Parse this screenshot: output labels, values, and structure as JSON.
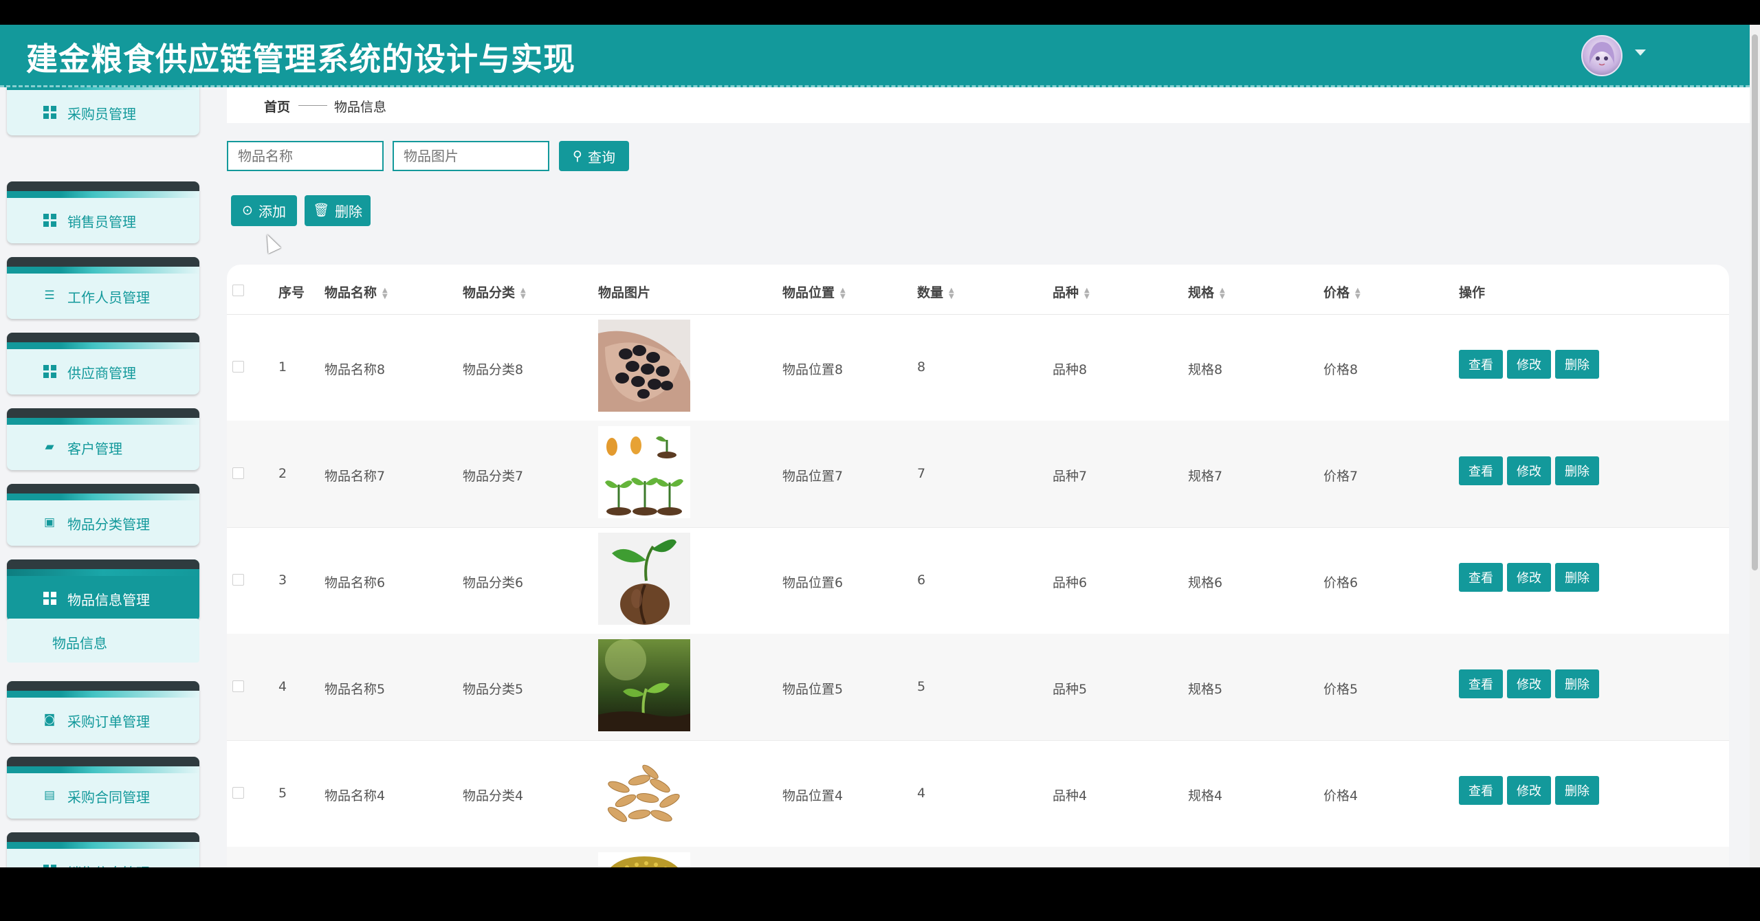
{
  "header": {
    "title": "建金粮食供应链管理系统的设计与实现"
  },
  "sidebar": {
    "items": [
      {
        "label": "采购员管理",
        "icon": "grid-icon"
      },
      {
        "label": "销售员管理",
        "icon": "grid-icon"
      },
      {
        "label": "工作人员管理",
        "icon": "sliders-icon"
      },
      {
        "label": "供应商管理",
        "icon": "grid-icon"
      },
      {
        "label": "客户管理",
        "icon": "folder-icon"
      },
      {
        "label": "物品分类管理",
        "icon": "briefcase-icon"
      },
      {
        "label": "物品信息管理",
        "icon": "grid-icon"
      },
      {
        "label": "采购订单管理",
        "icon": "camera-icon"
      },
      {
        "label": "采购合同管理",
        "icon": "clipboard-icon"
      },
      {
        "label": "销售信息管理",
        "icon": "grid-icon"
      }
    ],
    "active_submenu": "物品信息"
  },
  "breadcrumb": {
    "home": "首页",
    "current": "物品信息"
  },
  "search": {
    "name_placeholder": "物品名称",
    "image_placeholder": "物品图片",
    "query_label": "查询"
  },
  "toolbar": {
    "add_label": "添加",
    "delete_label": "删除"
  },
  "table": {
    "headers": {
      "index": "序号",
      "name": "物品名称",
      "category": "物品分类",
      "image": "物品图片",
      "location": "物品位置",
      "quantity": "数量",
      "variety": "品种",
      "spec": "规格",
      "price": "价格",
      "actions": "操作"
    },
    "rows": [
      {
        "index": "1",
        "name": "物品名称8",
        "category": "物品分类8",
        "location": "物品位置8",
        "quantity": "8",
        "variety": "品种8",
        "spec": "规格8",
        "price": "价格8",
        "image": "black-beans"
      },
      {
        "index": "2",
        "name": "物品名称7",
        "category": "物品分类7",
        "location": "物品位置7",
        "quantity": "7",
        "variety": "品种7",
        "spec": "规格7",
        "price": "价格7",
        "image": "seed-sprouts"
      },
      {
        "index": "3",
        "name": "物品名称6",
        "category": "物品分类6",
        "location": "物品位置6",
        "quantity": "6",
        "variety": "品种6",
        "spec": "规格6",
        "price": "价格6",
        "image": "coffee-bean-sprout"
      },
      {
        "index": "4",
        "name": "物品名称5",
        "category": "物品分类5",
        "location": "物品位置5",
        "quantity": "5",
        "variety": "品种5",
        "spec": "规格5",
        "price": "价格5",
        "image": "seedling-in-soil"
      },
      {
        "index": "5",
        "name": "物品名称4",
        "category": "物品分类4",
        "location": "物品位置4",
        "quantity": "4",
        "variety": "品种4",
        "spec": "规格4",
        "price": "价格4",
        "image": "oat-grains"
      },
      {
        "index": "",
        "name": "",
        "category": "",
        "location": "",
        "quantity": "",
        "variety": "",
        "spec": "",
        "price": "",
        "image": "millet-grains"
      }
    ],
    "row_actions": {
      "view": "查看",
      "edit": "修改",
      "delete": "删除"
    }
  },
  "colors": {
    "primary": "#13999b",
    "menu_bg": "#e3f6f7",
    "tab_dark": "#2f3b3f"
  }
}
